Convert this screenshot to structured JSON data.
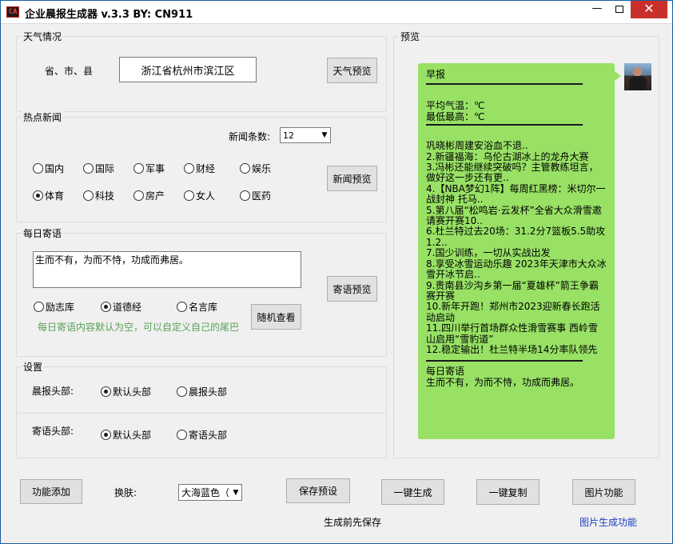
{
  "window": {
    "title": "企业晨报生成器  v.3.3 BY:  CN911",
    "app_icon_text": "CA"
  },
  "weather": {
    "legend": "天气情况",
    "region_label": "省、市、县",
    "region_value": "浙江省杭州市滨江区",
    "preview_button": "天气预览"
  },
  "news": {
    "legend": "热点新闻",
    "count_label": "新闻条数:",
    "count_value": "12",
    "preview_button": "新闻预览",
    "categories": [
      {
        "label": "国内",
        "selected": false
      },
      {
        "label": "国际",
        "selected": false
      },
      {
        "label": "军事",
        "selected": false
      },
      {
        "label": "财经",
        "selected": false
      },
      {
        "label": "娱乐",
        "selected": false
      },
      {
        "label": "体育",
        "selected": true
      },
      {
        "label": "科技",
        "selected": false
      },
      {
        "label": "房产",
        "selected": false
      },
      {
        "label": "女人",
        "selected": false
      },
      {
        "label": "医药",
        "selected": false
      }
    ]
  },
  "message": {
    "legend": "每日寄语",
    "text": "生而不有，为而不恃，功成而弗居。",
    "preview_button": "寄语预览",
    "random_button": "随机查看",
    "sources": [
      {
        "label": "励志库",
        "selected": false
      },
      {
        "label": "道德经",
        "selected": true
      },
      {
        "label": "名言库",
        "selected": false
      }
    ],
    "hint": "每日寄语内容默认为空，可以自定义自己的尾巴",
    "hint_color": "#5aa05a"
  },
  "settings": {
    "legend": "设置",
    "morning_header_label": "晨报头部:",
    "morning_options": [
      {
        "label": "默认头部",
        "selected": true
      },
      {
        "label": "晨报头部",
        "selected": false
      }
    ],
    "message_header_label": "寄语头部:",
    "message_options": [
      {
        "label": "默认头部",
        "selected": true
      },
      {
        "label": "寄语头部",
        "selected": false
      }
    ]
  },
  "preview": {
    "legend": "预览",
    "bubble_color": "#98e165",
    "title": "早报",
    "avg_temp": "平均气温：℃",
    "min_max": "最低最高：℃",
    "headline": "巩晓彬周建安浴血不退..",
    "news_items": [
      "2.新疆福海：乌伦古湖冰上的龙舟大赛",
      "3.冯彬还能继续突破吗？主管教练坦言，做好这一步还有更..",
      "4.【NBA梦幻1阵】每周红黑榜：米切尔一战封神 托马..",
      "5.第八届“松鸣岩·云发杯”全省大众滑雪邀请赛开赛10..",
      "6.杜兰特过去20场：31.2分7篮板5.5助攻1.2..",
      "7.国少训练，一切从实战出发",
      "8.享受冰雪运动乐趣 2023年天津市大众冰雪开冰节启..",
      "9.贵南县沙沟乡第一届“夏雄杯”箭王争霸赛开赛",
      "10.新年开跑！郑州市2023迎新春长跑活动启动",
      "11.四川举行首场群众性滑雪赛事 西岭雪山启用“雪豹道”",
      "12.稳定输出！杜兰特半场14分率队领先"
    ],
    "footer_title": "每日寄语",
    "footer_text": "生而不有，为而不恃，功成而弗居。"
  },
  "bottom": {
    "add_feature_button": "功能添加",
    "skin_label": "换肤:",
    "skin_value": "大海蓝色（",
    "save_preset_button": "保存预设",
    "generate_button": "一键生成",
    "copy_button": "一键复制",
    "image_button": "图片功能",
    "save_hint": "生成前先保存",
    "image_link": "图片生成功能",
    "link_color": "#1a3fbf"
  }
}
